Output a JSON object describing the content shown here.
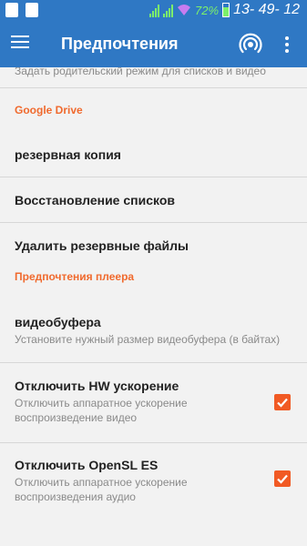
{
  "status_bar": {
    "battery_percent": "72%",
    "time": "13- 49- 12"
  },
  "app_bar": {
    "title": "Предпочтения"
  },
  "partial_item": {
    "subtitle": "Задать родительский режим для списков и видео"
  },
  "sections": [
    {
      "header": "Google Drive",
      "items": [
        {
          "title": "резервная копия"
        },
        {
          "title": "Восстановление списков"
        },
        {
          "title": "Удалить резервные файлы"
        }
      ]
    },
    {
      "header": "Предпочтения плеера",
      "items": [
        {
          "title": "видеобуфера",
          "subtitle": "Установите нужный размер видеобуфера (в байтах)"
        },
        {
          "title": "Отключить HW ускорение",
          "subtitle": "Отключить аппаратное ускорение воспроизведение видео",
          "checked": true
        },
        {
          "title": "Отключить OpenSL ES",
          "subtitle": "Отключить аппаратное ускорение воспроизведения аудио",
          "checked": true
        }
      ]
    }
  ],
  "colors": {
    "primary": "#2f78c4",
    "accent": "#f06a2e",
    "checkbox": "#f15a24"
  }
}
